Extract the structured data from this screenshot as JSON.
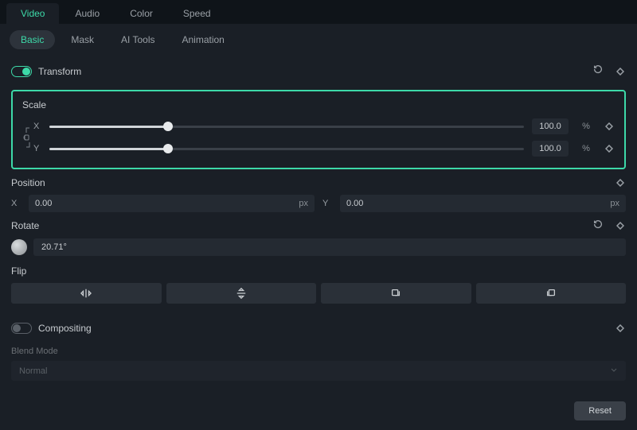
{
  "tabs_main": [
    "Video",
    "Audio",
    "Color",
    "Speed"
  ],
  "tabs_main_active": 0,
  "tabs_sub": [
    "Basic",
    "Mask",
    "AI Tools",
    "Animation"
  ],
  "tabs_sub_active": 0,
  "transform": {
    "label": "Transform",
    "enabled": true
  },
  "scale": {
    "title": "Scale",
    "x_label": "X",
    "y_label": "Y",
    "x_value": "100.0",
    "y_value": "100.0",
    "unit": "%",
    "x_pct": 25,
    "y_pct": 25
  },
  "position": {
    "title": "Position",
    "x_label": "X",
    "y_label": "Y",
    "x_value": "0.00",
    "y_value": "0.00",
    "unit": "px"
  },
  "rotate": {
    "title": "Rotate",
    "value": "20.71°"
  },
  "flip": {
    "title": "Flip"
  },
  "compositing": {
    "label": "Compositing",
    "enabled": false
  },
  "blend": {
    "label": "Blend Mode",
    "value": "Normal"
  },
  "footer": {
    "reset": "Reset"
  }
}
